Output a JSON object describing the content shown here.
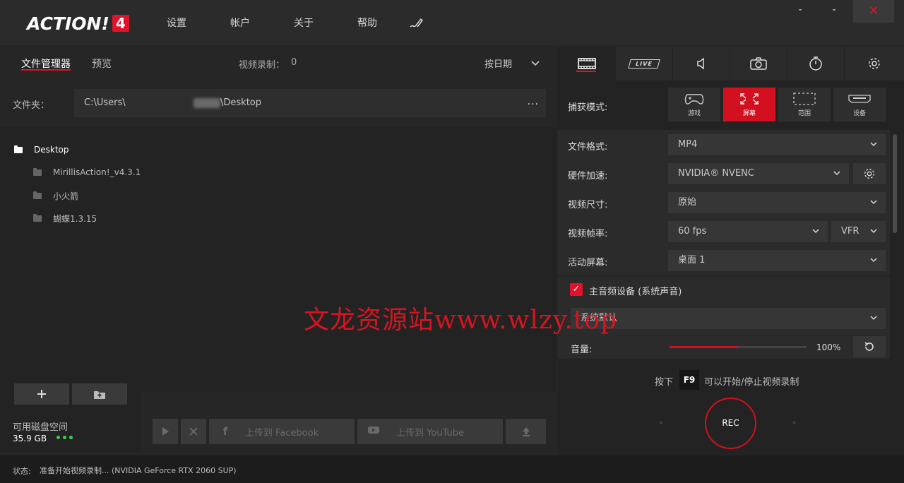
{
  "app": {
    "logo_text": "ACTION!",
    "logo_number": "4"
  },
  "menu": {
    "settings": "设置",
    "account": "帐户",
    "about": "关于",
    "help": "帮助"
  },
  "window": {
    "minimize": "-",
    "maximize": "-",
    "close": "✕"
  },
  "left": {
    "tabs": {
      "files": "文件管理器",
      "preview": "预览"
    },
    "video_count_label": "视频录制：",
    "video_count": "0",
    "sort_label": "按日期",
    "folder_label": "文件夹：",
    "folder_path_prefix": "C:\\Users\\",
    "folder_path_suffix": "\\Desktop",
    "folder_more": "...",
    "tree": [
      {
        "label": "Desktop"
      },
      {
        "label": "MirillisAction!_v4.3.1..."
      },
      {
        "label": "小火箭"
      },
      {
        "label": "蝴蝶1.3.15"
      }
    ],
    "disk_label": "可用磁盘空间",
    "disk_size": "35.9 GB",
    "upload_facebook": "上传到 Facebook",
    "upload_youtube": "上传到 YouTube"
  },
  "status": {
    "label": "状态:",
    "text": "准备开始视频录制... (NVIDIA GeForce RTX 2060 SUP)"
  },
  "right": {
    "tab_live": "LIVE",
    "capture_label": "捕获模式:",
    "capture_modes": [
      {
        "label": "游戏"
      },
      {
        "label": "屏幕"
      },
      {
        "label": "范围"
      },
      {
        "label": "设备"
      }
    ],
    "settings": {
      "format_label": "文件格式:",
      "format_value": "MP4",
      "hw_label": "硬件加速:",
      "hw_value": "NVIDIA® NVENC",
      "size_label": "视频尺寸:",
      "size_value": "原始",
      "fps_label": "视频帧率:",
      "fps_value": "60 fps",
      "fps_mode": "VFR",
      "screen_label": "活动屏幕:",
      "screen_value": "桌面 1"
    },
    "audio": {
      "title": "主音频设备 (系统声音)",
      "device": "系统默认",
      "volume_label": "音量:",
      "volume_value": "100%",
      "volume_fraction": 0.5
    },
    "hotkey_pre": "按下",
    "hotkey_key": "F9",
    "hotkey_post": "可以开始/停止视频录制",
    "rec_label": "REC"
  },
  "watermark": "文龙资源站www.wlzy.top",
  "colors": {
    "accent": "#d3101f",
    "background": "#232323",
    "topbar": "#2b2b2b",
    "disk_ok": "#3ccf4e"
  }
}
